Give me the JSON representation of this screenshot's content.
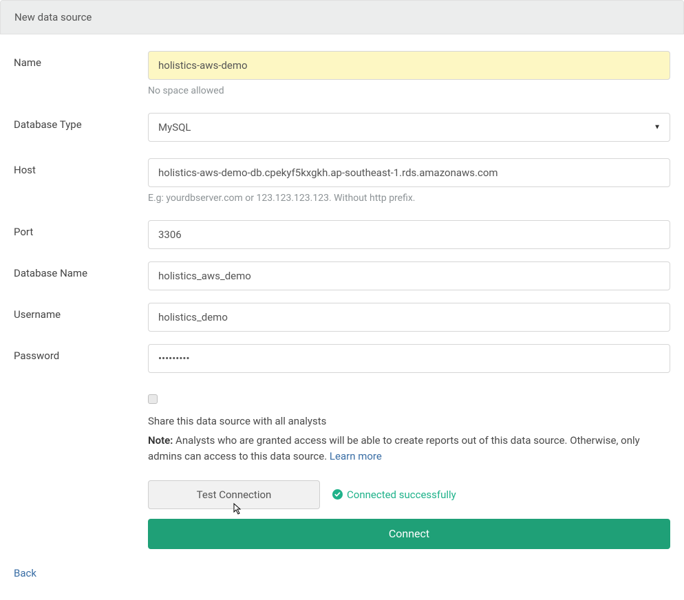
{
  "header": {
    "title": "New data source"
  },
  "labels": {
    "name": "Name",
    "dbtype": "Database Type",
    "host": "Host",
    "port": "Port",
    "dbname": "Database Name",
    "username": "Username",
    "password": "Password"
  },
  "fields": {
    "name": {
      "value": "holistics-aws-demo",
      "hint": "No space allowed"
    },
    "dbtype": {
      "value": "MySQL"
    },
    "host": {
      "value": "holistics-aws-demo-db.cpekyf5kxgkh.ap-southeast-1.rds.amazonaws.com",
      "hint": "E.g: yourdbserver.com or 123.123.123.123. Without http prefix."
    },
    "port": {
      "value": "3306"
    },
    "dbname": {
      "value": "holistics_aws_demo"
    },
    "username": {
      "value": "holistics_demo"
    },
    "password": {
      "value": "•••••••••"
    }
  },
  "share": {
    "label": "Share this data source with all analysts",
    "note_prefix": "Note:",
    "note_body": " Analysts who are granted access will be able to create reports out of this data source. Otherwise, only admins can access to this data source. ",
    "learn_more": "Learn more"
  },
  "actions": {
    "test": "Test Connection",
    "status": "Connected successfully",
    "connect": "Connect"
  },
  "back": "Back"
}
